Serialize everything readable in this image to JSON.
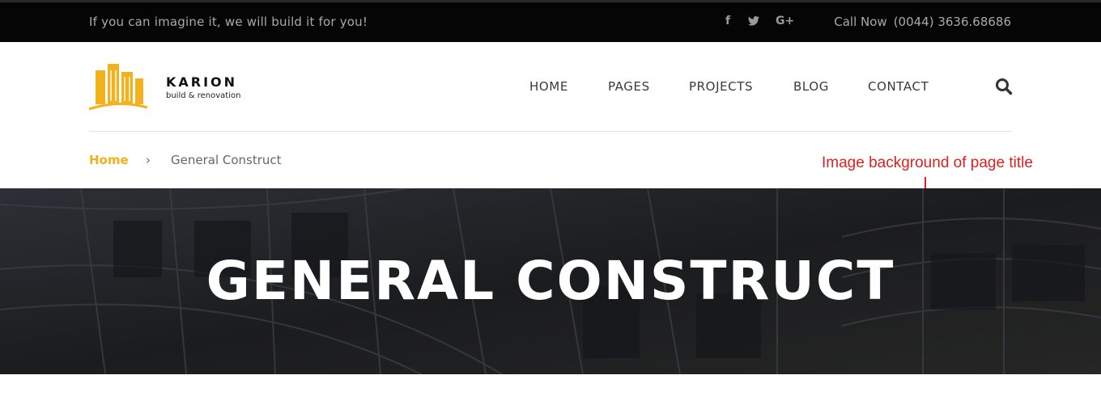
{
  "topbar": {
    "tagline": "If you can imagine it, we will build it for you!",
    "social_icons": [
      "facebook-icon",
      "twitter-icon",
      "google-plus-icon"
    ],
    "facebook_glyph": "f",
    "twitter_glyph": "🐦",
    "googleplus_glyph": "G+",
    "call_label": "Call Now",
    "phone": "(0044) 3636.68686"
  },
  "logo": {
    "name": "KARION",
    "subtitle": "build & renovation",
    "icon": "buildings-icon",
    "color": "#f3b11b"
  },
  "nav": {
    "items": [
      "HOME",
      "PAGES",
      "PROJECTS",
      "BLOG",
      "CONTACT"
    ],
    "search_icon": "search-icon"
  },
  "breadcrumb": {
    "home": "Home",
    "separator": "›",
    "current": "General Construct"
  },
  "annotation": {
    "text": "Image background of page title",
    "color": "#e02020"
  },
  "hero": {
    "title": "GENERAL CONSTRUCT"
  },
  "colors": {
    "accent": "#f3b11b",
    "topbar_bg": "#050505",
    "hero_bg": "#202020"
  }
}
